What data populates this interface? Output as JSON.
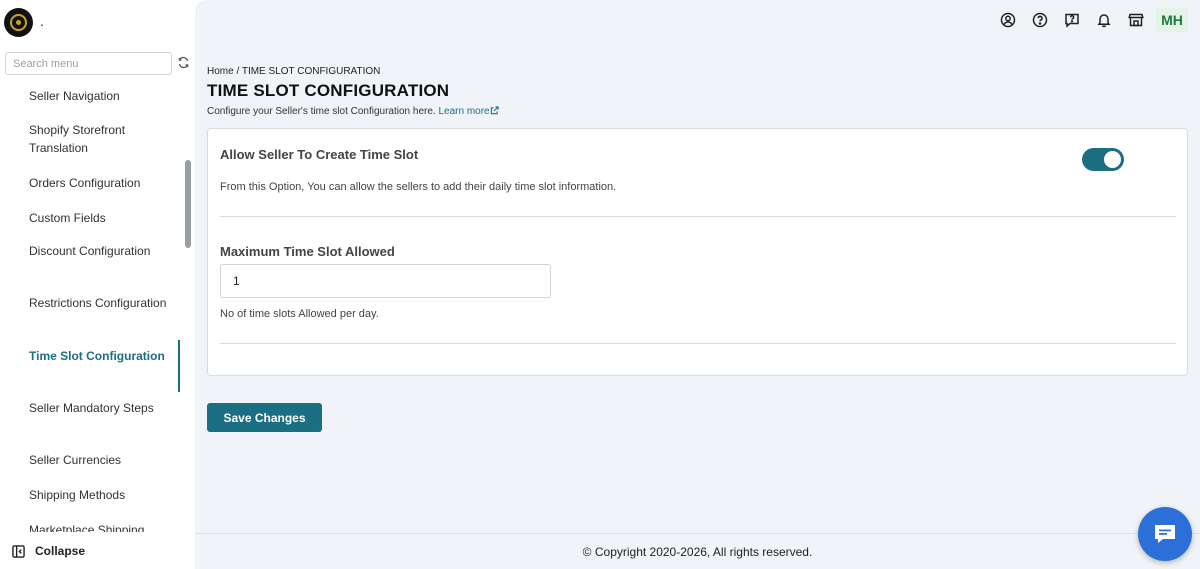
{
  "app": {
    "shop_name": "."
  },
  "sidebar": {
    "search_placeholder": "Search menu",
    "items": [
      {
        "label": "Seller Navigation"
      },
      {
        "label": "Shopify Storefront Translation"
      },
      {
        "label": "Orders Configuration"
      },
      {
        "label": "Custom Fields"
      },
      {
        "label": "Discount Configuration"
      },
      {
        "label": "Restrictions Configuration"
      },
      {
        "label": "Time Slot Configuration",
        "active": true
      },
      {
        "label": "Seller Mandatory Steps"
      },
      {
        "label": "Seller Currencies"
      },
      {
        "label": "Shipping Methods"
      },
      {
        "label": "Marketplace Shipping"
      }
    ],
    "collapse_label": "Collapse"
  },
  "header": {
    "icons": [
      "account-icon",
      "help-icon",
      "feedback-icon",
      "bell-icon",
      "store-icon"
    ],
    "avatar_initials": "MH"
  },
  "page": {
    "breadcrumb_home": "Home",
    "breadcrumb_sep": " / ",
    "breadcrumb_current": "TIME SLOT CONFIGURATION",
    "title": "TIME SLOT CONFIGURATION",
    "description": "Configure your Seller's time slot Configuration here.",
    "learn_more": "Learn more"
  },
  "settings": {
    "allow_title": "Allow Seller To Create Time Slot",
    "allow_enabled": true,
    "allow_description": "From this Option, You can allow the sellers to add their daily time slot information.",
    "max_label": "Maximum Time Slot Allowed",
    "max_value": "1",
    "max_help": "No of time slots Allowed per day."
  },
  "actions": {
    "save_label": "Save Changes"
  },
  "footer": {
    "copyright": "© Copyright 2020-2026, All rights reserved."
  },
  "colors": {
    "accent": "#1b6f83",
    "chat": "#2d6fd9",
    "avatar_bg": "#e3f4e6",
    "avatar_text": "#1f7a3a"
  }
}
